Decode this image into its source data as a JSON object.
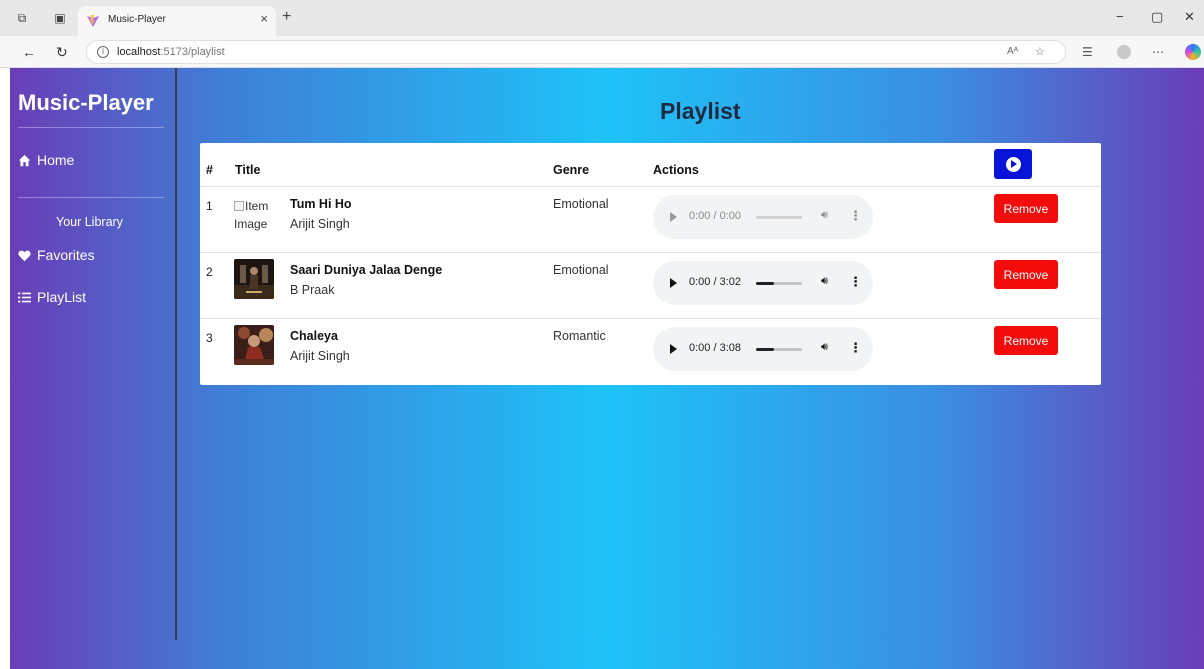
{
  "browser": {
    "tab_title": "Music-Player",
    "tab_close": "×",
    "new_tab": "+",
    "url_host": "localhost",
    "url_path": ":5173/playlist",
    "read_aloud": "Aᴬ",
    "window_controls": {
      "minimize": "−",
      "restore": "▢",
      "close": "✕"
    }
  },
  "sidebar": {
    "brand": "Music-Player",
    "home": "Home",
    "library_label": "Your Library",
    "favorites": "Favorites",
    "playlist": "PlayList"
  },
  "main": {
    "title": "Playlist",
    "columns": {
      "num": "#",
      "title": "Title",
      "genre": "Genre",
      "actions": "Actions"
    }
  },
  "tracks": [
    {
      "num": "1",
      "title": "Tum Hi Ho",
      "artist": "Arijit Singh",
      "genre": "Emotional",
      "time": "0:00 / 0:00",
      "image_alt": "Item Image",
      "image_broken": true,
      "progress": 0,
      "disabled": true,
      "remove": "Remove"
    },
    {
      "num": "2",
      "title": "Saari Duniya Jalaa Denge",
      "artist": "B Praak",
      "genre": "Emotional",
      "time": "0:00 / 3:02",
      "image_broken": false,
      "progress": 0.4,
      "disabled": false,
      "remove": "Remove"
    },
    {
      "num": "3",
      "title": "Chaleya",
      "artist": "Arijit Singh",
      "genre": "Romantic",
      "time": "0:00 / 3:08",
      "image_broken": false,
      "progress": 0.4,
      "disabled": false,
      "remove": "Remove"
    }
  ],
  "colors": {
    "accent_blue": "#0814d8",
    "remove_red": "#f30c0c",
    "gradient_edge": "#6a3db7",
    "gradient_center": "#1ec3f8"
  }
}
